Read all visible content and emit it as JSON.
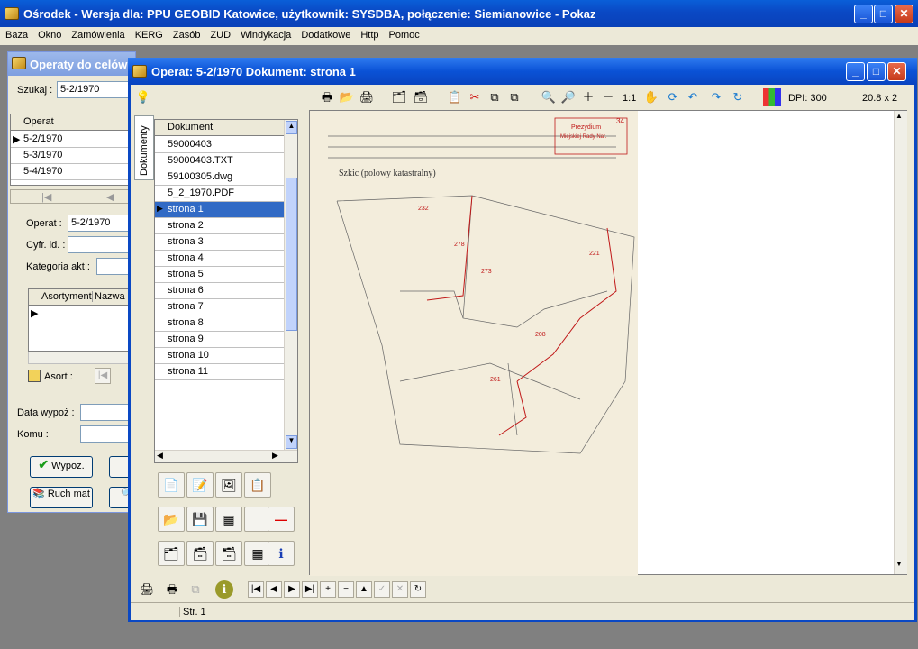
{
  "app": {
    "title": "Ośrodek - Wersja dla: PPU GEOBID Katowice, użytkownik: SYSDBA, połączenie: Siemianowice - Pokaz"
  },
  "menu": [
    "Baza",
    "Okno",
    "Zamówienia",
    "KERG",
    "Zasób",
    "ZUD",
    "Windykacja",
    "Dodatkowe",
    "Http",
    "Pomoc"
  ],
  "operaty_window": {
    "title": "Operaty do celów",
    "search_label": "Szukaj :",
    "search_value": "5-2/1970",
    "grid_header": "Operat",
    "rows": [
      "5-2/1970",
      "5-3/1970",
      "5-4/1970"
    ],
    "operat_label": "Operat :",
    "operat_value": "5-2/1970",
    "cyfr_label": "Cyfr. id. :",
    "kategoria_label": "Kategoria akt :",
    "asort_headers": [
      "Asortyment",
      "Nazwa"
    ],
    "asort_button": "Asort :",
    "data_wypoz_label": "Data wypoż :",
    "komu_label": "Komu :",
    "wypoz_button": "Wypoż.",
    "ruch_button": "Ruch mat"
  },
  "doc_window": {
    "title": "Operat: 5-2/1970   Dokument: strona   1",
    "side_tab": "Dokumenty",
    "list_header": "Dokument",
    "items": [
      "59000403",
      "59000403.TXT",
      "59100305.dwg",
      "5_2_1970.PDF",
      "strona   1",
      "strona   2",
      "strona   3",
      "strona   4",
      "strona   5",
      "strona   6",
      "strona   7",
      "strona   8",
      "strona   9",
      "strona   10",
      "strona   11"
    ],
    "selected_index": 4,
    "zoom_label": "1:1",
    "dpi": "DPI: 300",
    "size": "20.8  x  2",
    "status": "Str. 1"
  },
  "map": {
    "header_title": "Szkic (polowy katastralny)",
    "stamp_line1": "Prezydium",
    "stamp_line2": "Miejskiej Rady Nar.",
    "page_number": "34"
  },
  "colors": {
    "title_blue": "#0a48c4",
    "selection": "#316ac5",
    "paper": "#f3eddc"
  }
}
